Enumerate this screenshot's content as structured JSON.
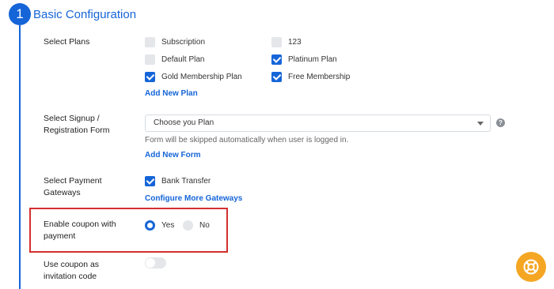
{
  "section": {
    "number": "1",
    "title": "Basic Configuration"
  },
  "plans": {
    "label": "Select Plans",
    "items": [
      {
        "label": "Subscription",
        "checked": false
      },
      {
        "label": "123",
        "checked": false
      },
      {
        "label": "Default Plan",
        "checked": false
      },
      {
        "label": "Platinum Plan",
        "checked": true
      },
      {
        "label": "Gold Membership Plan",
        "checked": true
      },
      {
        "label": "Free Membership",
        "checked": true
      }
    ],
    "add_link": "Add New Plan"
  },
  "signup_form": {
    "label_line1": "Select Signup /",
    "label_line2": "Registration Form",
    "select_value": "Choose you Plan",
    "help_icon": "question-circle-icon",
    "hint": "Form will be skipped automatically when user is logged in.",
    "add_link": "Add New Form"
  },
  "payment": {
    "label_line1": "Select Payment",
    "label_line2": "Gateways",
    "gateway": {
      "label": "Bank Transfer",
      "checked": true
    },
    "configure_link": "Configure More Gateways"
  },
  "coupon": {
    "label_line1": "Enable coupon with",
    "label_line2": "payment",
    "options": [
      {
        "label": "Yes",
        "selected": true
      },
      {
        "label": "No",
        "selected": false
      }
    ],
    "highlight_color": "#d32f2f"
  },
  "invitation": {
    "label_line1": "Use coupon as",
    "label_line2": "invitation code",
    "enabled": false
  },
  "help_button": {
    "icon": "lifebuoy-icon",
    "color": "#f5a623"
  },
  "colors": {
    "accent": "#1565d8"
  }
}
